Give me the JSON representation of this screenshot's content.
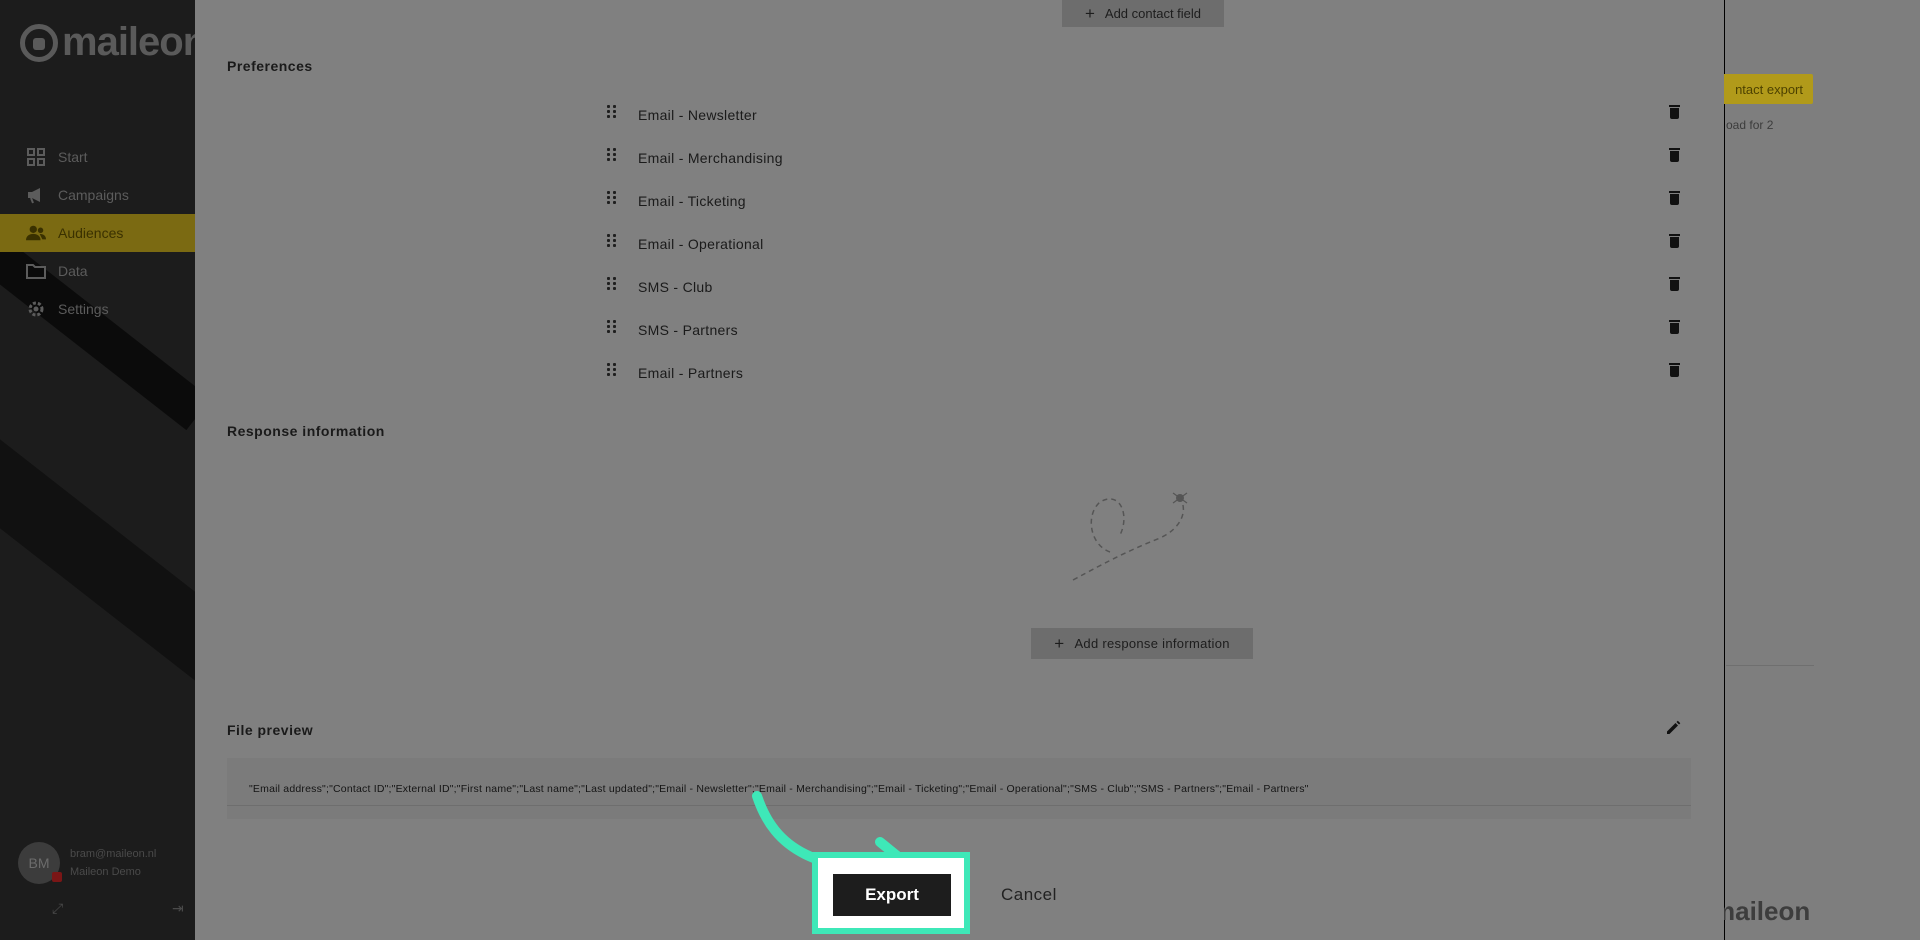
{
  "app": {
    "logo_text": "maileon"
  },
  "sidebar": {
    "items": [
      {
        "label": "Start",
        "icon": "grid-icon"
      },
      {
        "label": "Campaigns",
        "icon": "megaphone-icon"
      },
      {
        "label": "Audiences",
        "icon": "people-icon",
        "active": true
      },
      {
        "label": "Data",
        "icon": "folder-icon"
      },
      {
        "label": "Settings",
        "icon": "gear-icon"
      }
    ],
    "user": {
      "initials": "BM",
      "email": "bram@maileon.nl",
      "name": "Maileon Demo"
    },
    "active_color": "#f5d21d"
  },
  "background": {
    "action_button": "ntact export",
    "subtitle": "oad for 2",
    "footer_logo": "maileon"
  },
  "modal": {
    "add_contact_field": "Add contact field",
    "preferences": {
      "title": "Preferences",
      "items": [
        "Email - Newsletter",
        "Email - Merchandising",
        "Email - Ticketing",
        "Email - Operational",
        "SMS - Club",
        "SMS - Partners",
        "Email - Partners"
      ]
    },
    "response_information": {
      "title": "Response information",
      "add_button": "Add response information"
    },
    "file_preview": {
      "title": "File preview",
      "content": "\"Email address\";\"Contact ID\";\"External ID\";\"First name\";\"Last name\";\"Last updated\";\"Email - Newsletter\";\"Email - Merchandising\";\"Email - Ticketing\";\"Email - Operational\";\"SMS - Club\";\"SMS - Partners\";\"Email - Partners\""
    },
    "actions": {
      "export": "Export",
      "cancel": "Cancel"
    }
  },
  "colors": {
    "highlight": "#3ee8b8",
    "export_bg": "#1d1d1d"
  }
}
